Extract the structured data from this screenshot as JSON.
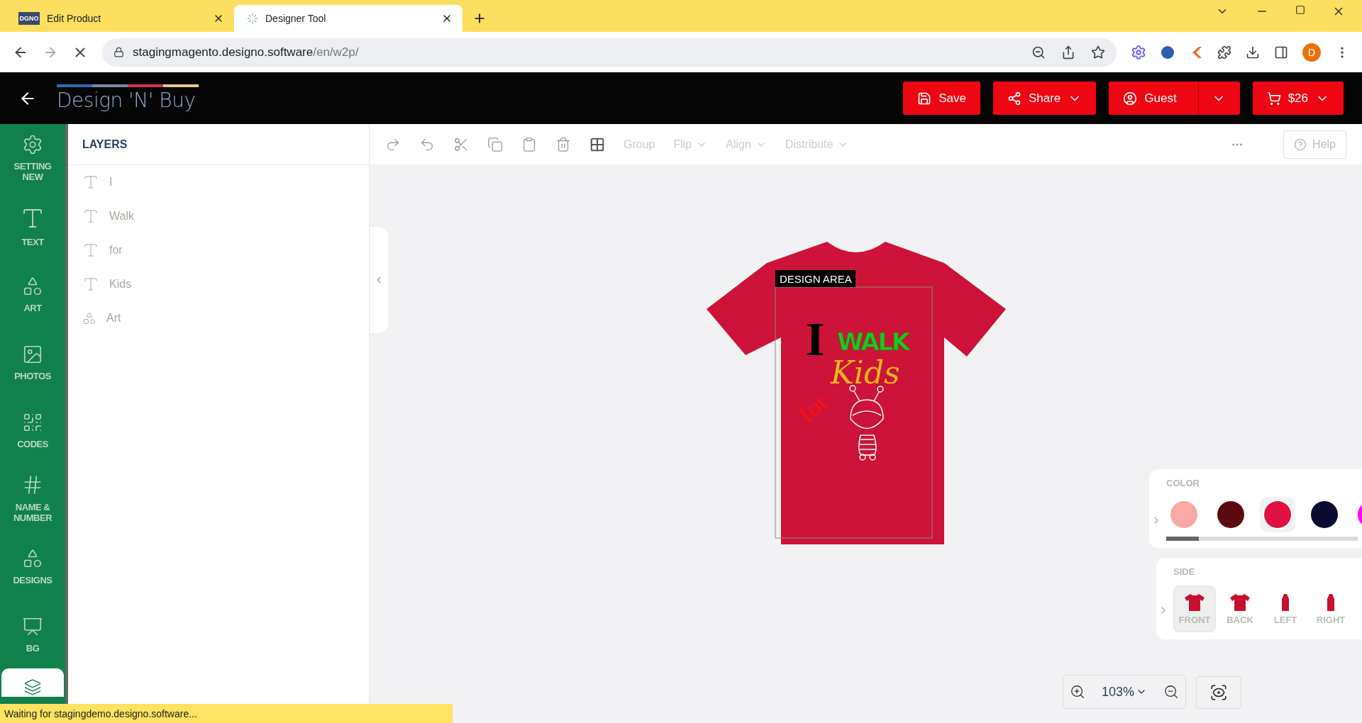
{
  "browser": {
    "tabs": [
      {
        "title": "Edit Product",
        "favicon": "DGNO",
        "selected": false
      },
      {
        "title": "Designer Tool",
        "selected": true
      }
    ],
    "url": {
      "host": "stagingmagento.designo.software",
      "path": "/en/w2p/"
    },
    "profile": "D"
  },
  "header": {
    "logo": "Design 'N' Buy",
    "buttons": [
      {
        "label": "Save",
        "kind": "save"
      },
      {
        "label": "Share",
        "kind": "share"
      },
      {
        "label": "Guest",
        "kind": "guest"
      },
      {
        "label": "$26",
        "kind": "cart"
      }
    ]
  },
  "sidebar": {
    "items": [
      {
        "label": "SETTING NEW",
        "kind": "settings",
        "selected": false
      },
      {
        "label": "TEXT",
        "kind": "text",
        "selected": false
      },
      {
        "label": "ART",
        "kind": "art",
        "selected": false
      },
      {
        "label": "PHOTOS",
        "kind": "photos",
        "selected": false
      },
      {
        "label": "CODES",
        "kind": "codes",
        "selected": false
      },
      {
        "label": "NAME & NUMBER",
        "kind": "number",
        "selected": false
      },
      {
        "label": "DESIGNS",
        "kind": "art",
        "selected": false
      },
      {
        "label": "BG",
        "kind": "bg",
        "selected": false
      },
      {
        "kind": "layers",
        "selected": true
      }
    ]
  },
  "layers": {
    "title": "LAYERS",
    "items": [
      {
        "name": "I",
        "kind": "text"
      },
      {
        "name": "Walk",
        "kind": "text"
      },
      {
        "name": "for",
        "kind": "text"
      },
      {
        "name": "Kids",
        "kind": "text"
      },
      {
        "name": "Art",
        "kind": "art"
      }
    ]
  },
  "toolbar": {
    "tools": [
      {
        "kind": "redo"
      },
      {
        "kind": "undo"
      },
      {
        "kind": "cut"
      },
      {
        "kind": "copy"
      },
      {
        "kind": "paste"
      },
      {
        "kind": "delete"
      },
      {
        "kind": "pattern"
      }
    ],
    "menus": [
      {
        "label": "Group",
        "dropdown": false
      },
      {
        "label": "Flip",
        "dropdown": true
      },
      {
        "label": "Align",
        "dropdown": true
      },
      {
        "label": "Distribute",
        "dropdown": true
      }
    ],
    "help": "Help"
  },
  "canvas": {
    "design_area_label": "DESIGN AREA",
    "design": {
      "word_1": "I",
      "word_2": "WALK",
      "word_3": "for",
      "word_4": "Kids"
    }
  },
  "color_panel": {
    "title": "COLOR",
    "swatches": [
      {
        "color": "#f9a8a4",
        "selected": false
      },
      {
        "color": "#5c0a10",
        "selected": false
      },
      {
        "color": "#e0123f",
        "selected": true
      },
      {
        "color": "#0b0a33",
        "selected": false
      },
      {
        "color": "#ff00ff",
        "selected": false
      }
    ]
  },
  "side_panel": {
    "title": "SIDE",
    "sides": [
      {
        "label": "FRONT",
        "kind": "front",
        "selected": true
      },
      {
        "label": "BACK",
        "kind": "back",
        "selected": false
      },
      {
        "label": "LEFT",
        "kind": "left",
        "selected": false
      },
      {
        "label": "RIGHT",
        "kind": "right",
        "selected": false
      }
    ]
  },
  "zoom": {
    "value": "103%"
  },
  "status_bar": "Waiting for stagingdemo.designo.software..."
}
